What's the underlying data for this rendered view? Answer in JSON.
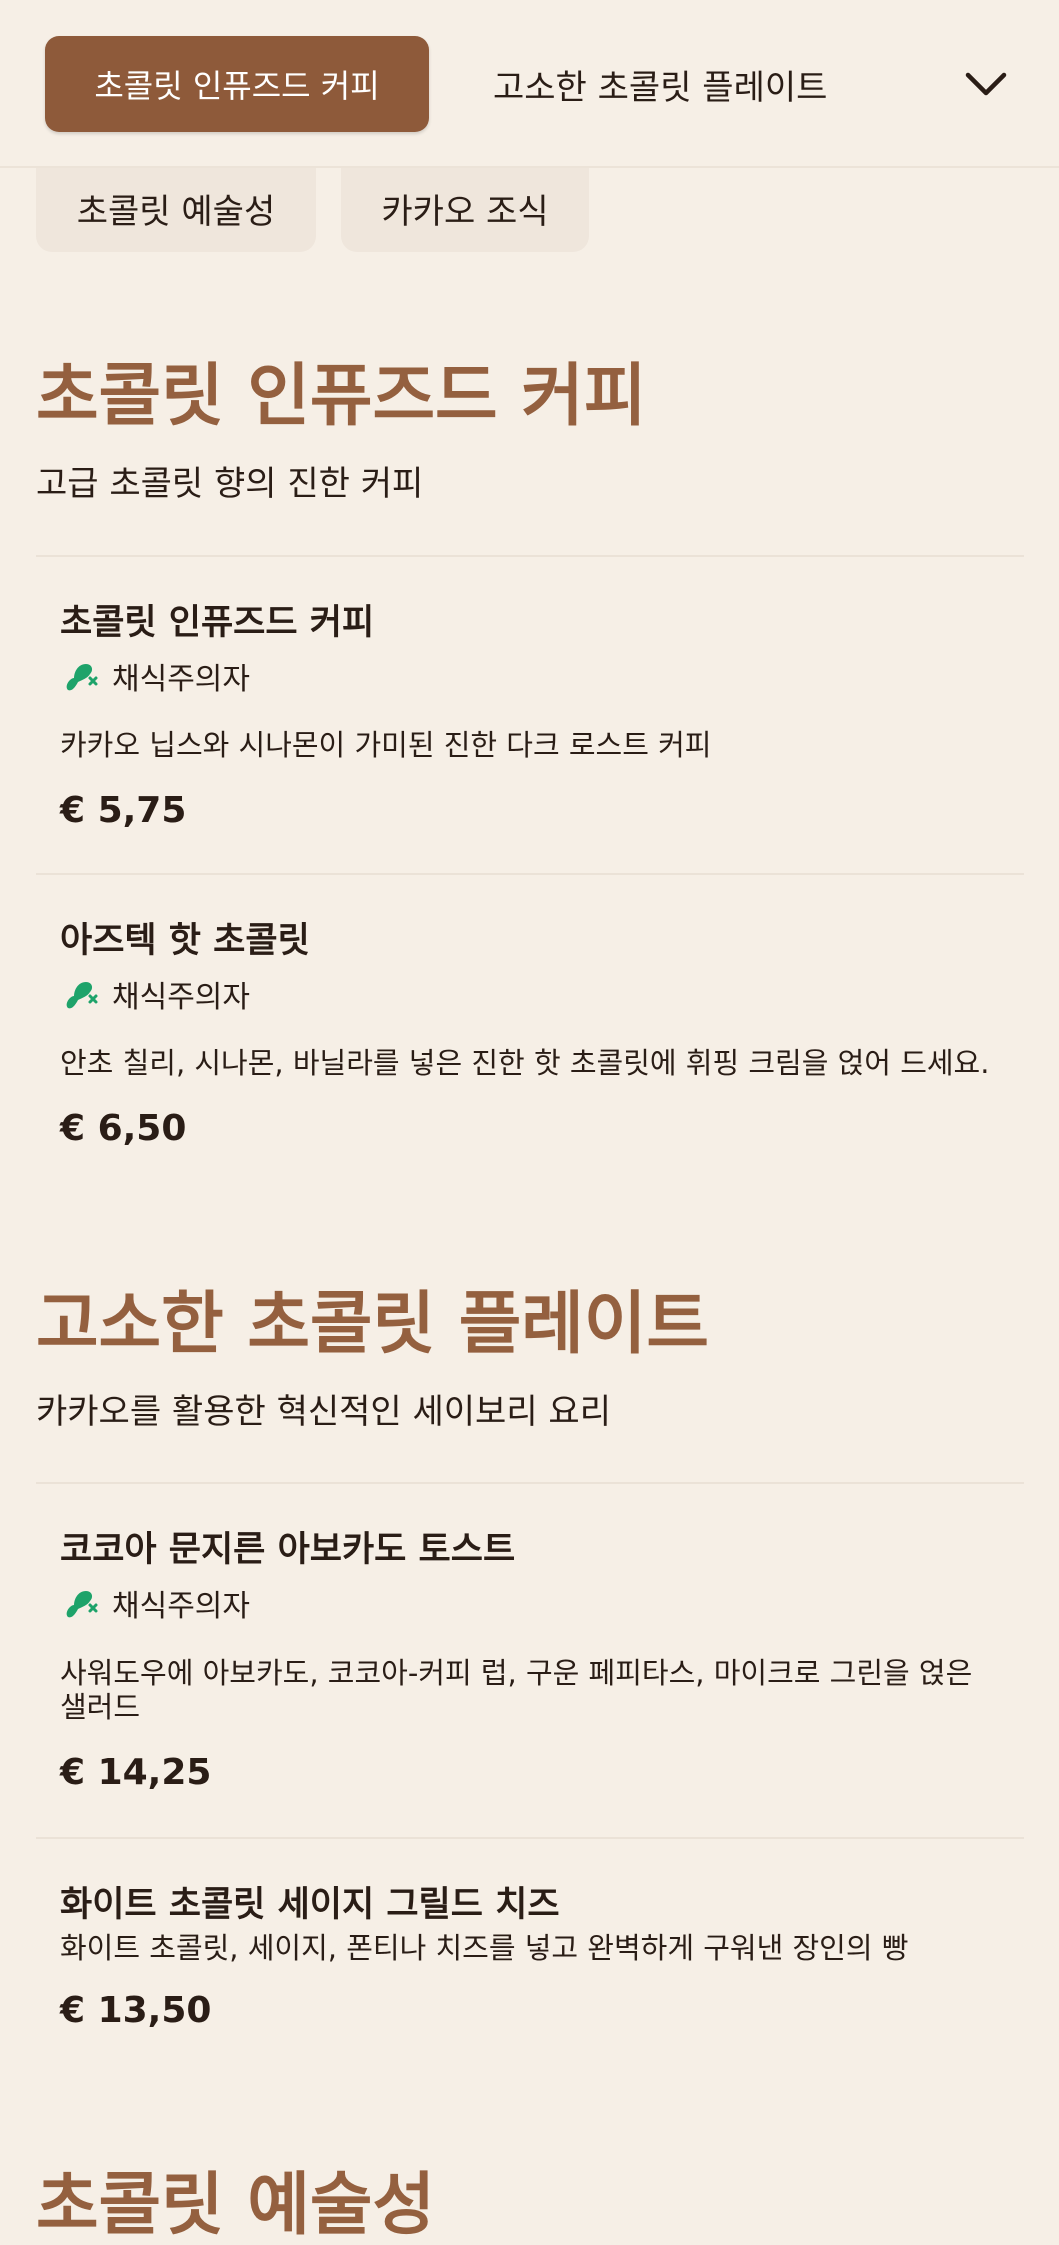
{
  "category_bar": {
    "active_tab": "초콜릿 인퓨즈드 커피",
    "next_tab": "고소한 초콜릿 플레이트",
    "expand_icon": "chevron-down-icon",
    "chips": [
      "초콜릿 예술성",
      "카카오 조식"
    ]
  },
  "colors": {
    "background": "#f6efe6",
    "accent": "#8e5a3a",
    "section_title": "#94603f",
    "vegetarian_icon": "#1ea36a"
  },
  "sections": [
    {
      "title": "초콜릿 인퓨즈드 커피",
      "subtitle": "고급 초콜릿 향의 진한 커피",
      "items": [
        {
          "name": "초콜릿 인퓨즈드 커피",
          "badge": "채식주의자",
          "description": "카카오 닙스와 시나몬이 가미된 진한 다크 로스트 커피",
          "price": "€ 5,75"
        },
        {
          "name": "아즈텍 핫 초콜릿",
          "badge": "채식주의자",
          "description": "안초 칠리, 시나몬, 바닐라를 넣은 진한 핫 초콜릿에 휘핑 크림을 얹어 드세요.",
          "price": "€ 6,50"
        }
      ]
    },
    {
      "title": "고소한 초콜릿 플레이트",
      "subtitle": "카카오를 활용한 혁신적인 세이보리 요리",
      "items": [
        {
          "name": "코코아 문지른 아보카도 토스트",
          "badge": "채식주의자",
          "description": "사워도우에 아보카도, 코코아-커피 럽, 구운 페피타스, 마이크로 그린을 얹은 샐러드",
          "price": "€ 14,25"
        },
        {
          "name": "화이트 초콜릿 세이지 그릴드 치즈",
          "description": "화이트 초콜릿, 세이지, 폰티나 치즈를 넣고 완벽하게 구워낸 장인의 빵",
          "price": "€ 13,50"
        }
      ]
    },
    {
      "title": "초콜릿 예술성"
    }
  ]
}
